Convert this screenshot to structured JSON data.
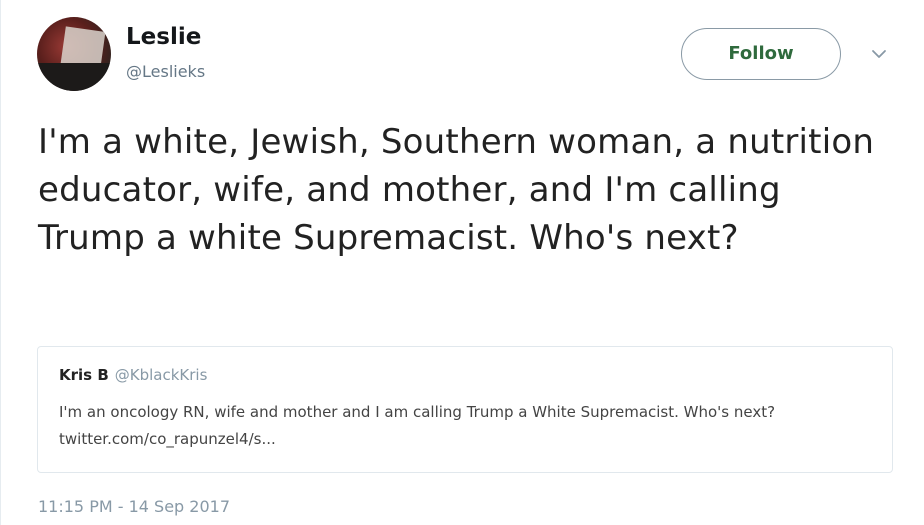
{
  "author": {
    "name": "Leslie",
    "handle": "@Leslieks"
  },
  "follow_button": {
    "label": "Follow",
    "color": "#2f6a3d"
  },
  "menu_icon": "chevron-down-icon",
  "tweet": {
    "text": "I'm a white, Jewish, Southern woman, a nutrition educator, wife, and mother, and I'm calling Trump a white Supremacist. Who's next?",
    "timestamp": "11:15 PM - 14 Sep 2017"
  },
  "quoted_tweet": {
    "name": "Kris B",
    "handle": "@KblackKris",
    "text": "I'm an oncology RN, wife and mother and I am calling Trump a White Supremacist. Who's next? twitter.com/co_rapunzel4/s..."
  },
  "colors": {
    "text_primary": "#14171a",
    "text_secondary": "#657786",
    "border": "#e1e8ed"
  }
}
